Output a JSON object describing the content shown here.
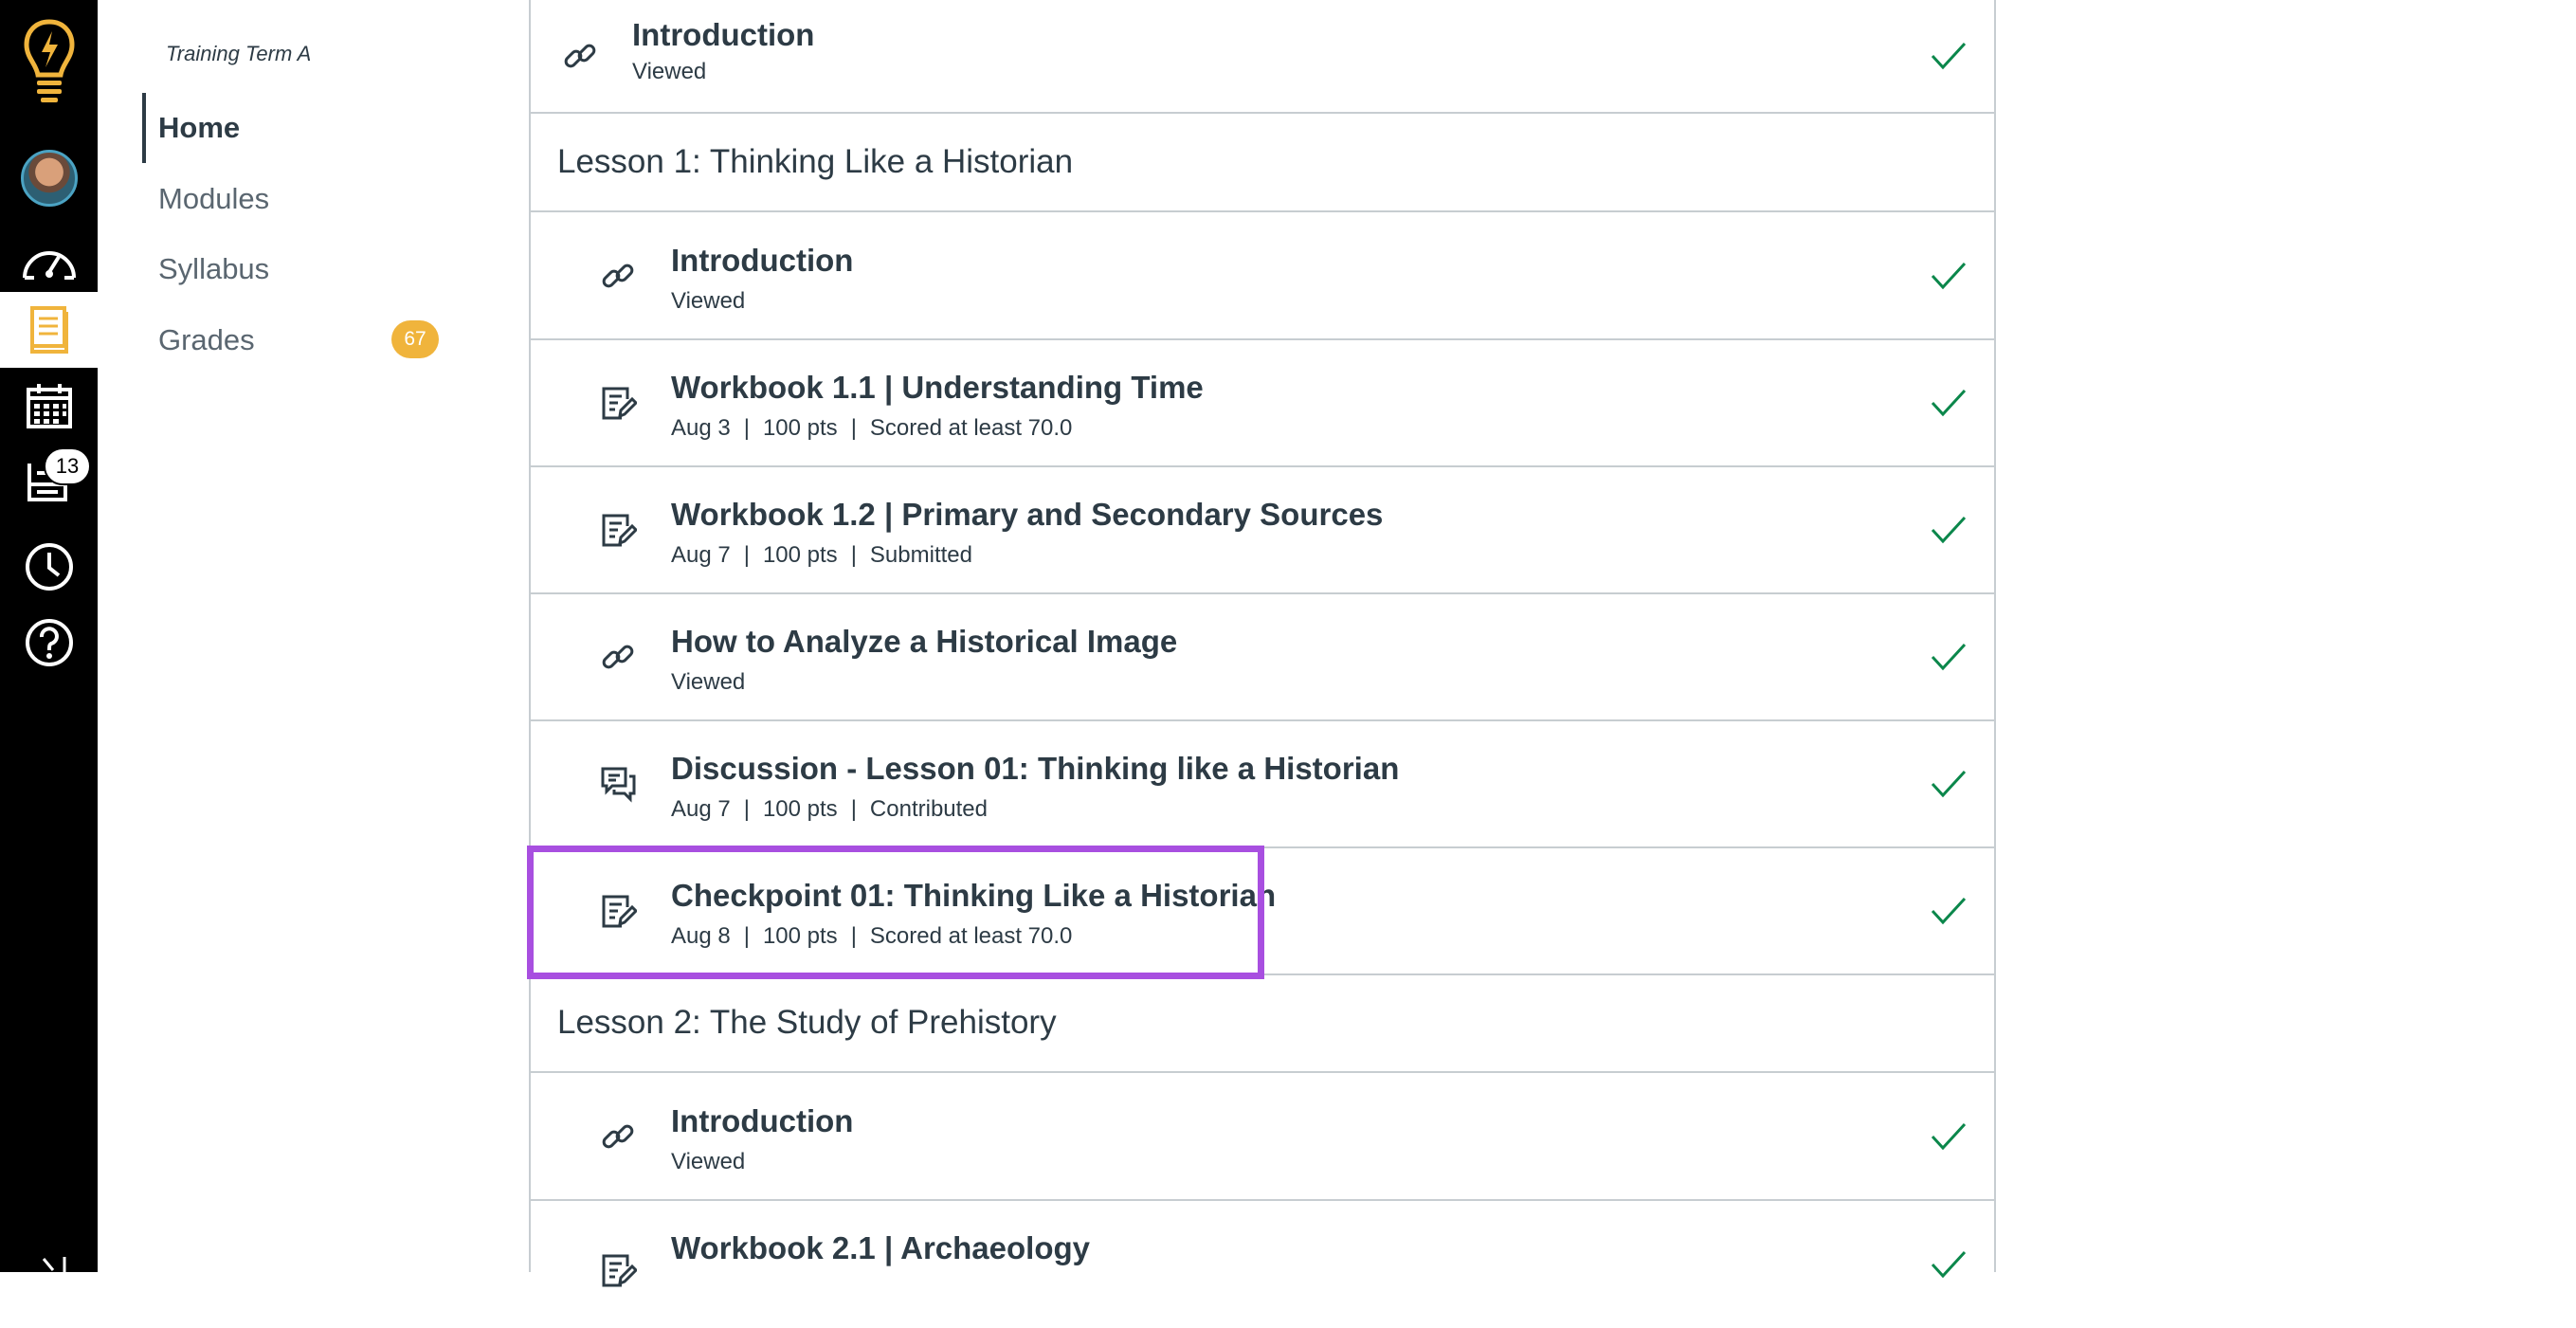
{
  "global_nav": {
    "icons": [
      "lightbulb-logo-icon",
      "avatar",
      "dashboard-icon",
      "courses-icon",
      "calendar-icon",
      "inbox-icon",
      "history-icon",
      "help-icon",
      "collapse-icon"
    ],
    "inbox_badge": "13"
  },
  "course_nav": {
    "term": "Training Term A",
    "items": [
      {
        "label": "Home"
      },
      {
        "label": "Modules"
      },
      {
        "label": "Syllabus"
      },
      {
        "label": "Grades",
        "badge": "67"
      }
    ]
  },
  "modules": {
    "top_item": {
      "title": "Introduction",
      "meta": "Viewed",
      "icon": "link-icon"
    },
    "lesson1": {
      "title": "Lesson 1: Thinking Like a Historian",
      "items": [
        {
          "title": "Introduction",
          "meta": [
            "Viewed"
          ],
          "icon": "link-icon"
        },
        {
          "title": "Workbook 1.1 | Understanding Time",
          "meta": [
            "Aug 3",
            "100 pts",
            "Scored at least 70.0"
          ],
          "icon": "assignment-icon"
        },
        {
          "title": "Workbook 1.2 | Primary and Secondary Sources",
          "meta": [
            "Aug 7",
            "100 pts",
            "Submitted"
          ],
          "icon": "assignment-icon"
        },
        {
          "title": "How to Analyze a Historical Image",
          "meta": [
            "Viewed"
          ],
          "icon": "link-icon"
        },
        {
          "title": "Discussion - Lesson 01: Thinking like a Historian",
          "meta": [
            "Aug 7",
            "100 pts",
            "Contributed"
          ],
          "icon": "discussion-icon"
        },
        {
          "title": "Checkpoint 01: Thinking Like a Historian",
          "meta": [
            "Aug 8",
            "100 pts",
            "Scored at least 70.0"
          ],
          "icon": "assignment-icon"
        }
      ]
    },
    "lesson2": {
      "title": "Lesson 2: The Study of Prehistory",
      "items": [
        {
          "title": "Introduction",
          "meta": [
            "Viewed"
          ],
          "icon": "link-icon"
        },
        {
          "title": "Workbook 2.1 | Archaeology",
          "meta": [],
          "icon": "assignment-icon"
        }
      ]
    },
    "separator": "|"
  },
  "colors": {
    "nav_bg": "#000000",
    "accent_orange": "#f0b43c",
    "check_green": "#0b874b",
    "highlight": "#a84fe0",
    "border": "#c7cdd1"
  }
}
